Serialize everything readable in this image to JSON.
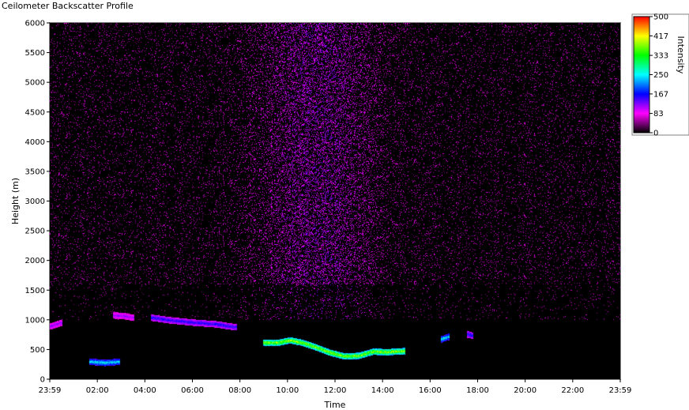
{
  "window": {
    "title": "Ceilometer Backscatter Profile"
  },
  "chart_data": {
    "type": "heatmap",
    "title": "Ceilometer Backscatter Profile",
    "xlabel": "Time",
    "ylabel": "Height (m)",
    "x_tick_labels": [
      "23:59",
      "02:00",
      "04:00",
      "06:00",
      "08:00",
      "10:00",
      "12:00",
      "14:00",
      "16:00",
      "18:00",
      "20:00",
      "22:00",
      "23:59"
    ],
    "x_range_hours": [
      0,
      24
    ],
    "y_ticks": [
      0,
      500,
      1000,
      1500,
      2000,
      2500,
      3000,
      3500,
      4000,
      4500,
      5000,
      5500,
      6000
    ],
    "ylim": [
      0,
      6000
    ],
    "colorbar": {
      "label": "Intensity",
      "ticks": [
        0,
        83,
        167,
        250,
        333,
        417,
        500
      ],
      "tick_labels": [
        "0",
        "83",
        "167",
        "250",
        "333",
        "417",
        "500"
      ],
      "range": [
        0,
        500
      ],
      "colors": [
        "#000000",
        "#ff00ff",
        "#0000ff",
        "#00ffff",
        "#00ff00",
        "#ffff00",
        "#ff0000"
      ]
    },
    "background_colors": {
      "plot": "#000000",
      "noise": "#ff00ff"
    },
    "cloud_layers": [
      {
        "name": "",
        "points": [
          [
            0.05,
            900
          ],
          [
            0.45,
            950
          ]
        ],
        "intensity": 120
      },
      {
        "name": "",
        "points": [
          [
            1.7,
            300
          ],
          [
            2.3,
            280
          ],
          [
            2.9,
            300
          ]
        ],
        "intensity": 250
      },
      {
        "name": "",
        "points": [
          [
            2.7,
            1080
          ],
          [
            3.1,
            1070
          ],
          [
            3.5,
            1040
          ]
        ],
        "intensity": 120
      },
      {
        "name": "",
        "points": [
          [
            4.3,
            1040
          ],
          [
            5.0,
            1000
          ],
          [
            6.0,
            960
          ],
          [
            7.0,
            930
          ],
          [
            7.8,
            880
          ]
        ],
        "intensity": 160
      },
      {
        "name": "",
        "points": [
          [
            9.0,
            620
          ],
          [
            9.6,
            620
          ],
          [
            10.1,
            660
          ],
          [
            10.6,
            620
          ],
          [
            11.2,
            540
          ],
          [
            11.8,
            450
          ],
          [
            12.4,
            390
          ],
          [
            13.0,
            400
          ],
          [
            13.6,
            470
          ],
          [
            14.2,
            460
          ],
          [
            14.9,
            480
          ]
        ],
        "intensity": 380
      },
      {
        "name": "",
        "points": [
          [
            16.5,
            680
          ],
          [
            16.75,
            720
          ]
        ],
        "intensity": 250
      },
      {
        "name": "",
        "points": [
          [
            17.6,
            760
          ],
          [
            17.75,
            740
          ]
        ],
        "intensity": 170
      }
    ]
  }
}
